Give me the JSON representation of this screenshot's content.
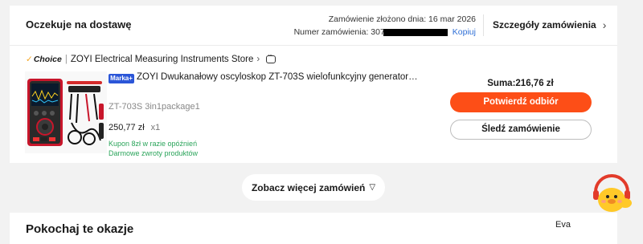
{
  "order": {
    "status": "Oczekuje na dostawę",
    "placed_label": "Zamówienie złożono dnia: 16 mar 2026",
    "number_prefix": "Numer zamówienia: 307",
    "copy_label": "Kopiuj",
    "details_label": "Szczegóły zamówienia"
  },
  "store": {
    "choice_label": "Choice",
    "name": "ZOYI Electrical Measuring Instruments Store"
  },
  "product": {
    "badge": "Marka+",
    "title": "ZOYI Dwukanałowy oscyloskop ZT-703S wielofunkcyjny generator ...",
    "variant": "ZT-703S 3in1package1",
    "price": "250,77 zł",
    "quantity": "x1",
    "promo_delay": "Kupon 8zł w razie opóźnień",
    "promo_returns": "Darmowe zwroty produktów"
  },
  "summary": {
    "total": "Suma:216,76 zł",
    "confirm_label": "Potwierdź odbiór",
    "track_label": "Śledź zamówienie"
  },
  "more_orders_label": "Zobacz więcej zamówień",
  "deals_title": "Pokochaj te okazje",
  "assistant": {
    "name": "Eva"
  },
  "colors": {
    "accent": "#fd4e17",
    "link": "#2f6fd6",
    "promo": "#2aa45a",
    "brand_badge": "#2b56d8"
  }
}
